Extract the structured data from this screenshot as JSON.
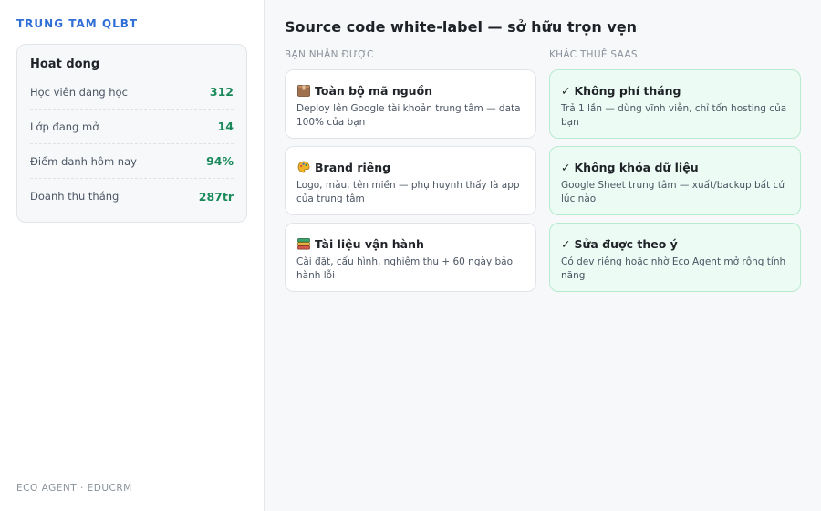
{
  "sidebar": {
    "brand": "TRUNG TAM QLBT",
    "stats": {
      "title": "Hoat dong",
      "rows": [
        {
          "label": "Học viên đang học",
          "value": "312"
        },
        {
          "label": "Lớp đang mở",
          "value": "14"
        },
        {
          "label": "Điểm danh hôm nay",
          "value": "94%"
        },
        {
          "label": "Doanh thu tháng",
          "value": "287tr"
        }
      ]
    },
    "footer": "ECO AGENT · EDUCRM"
  },
  "main": {
    "title": "Source code white-label — sở hữu trọn vẹn",
    "left": {
      "header": "BẠN NHẬN ĐƯỢC",
      "cards": [
        {
          "icon": "box-icon",
          "title": "Toàn bộ mã nguồn",
          "desc": "Deploy lên Google tài khoản trung tâm — data 100% của bạn"
        },
        {
          "icon": "palette-icon",
          "title": "Brand riêng",
          "desc": "Logo, màu, tên miền — phụ huynh thấy là app của trung tâm"
        },
        {
          "icon": "books-icon",
          "title": "Tài liệu vận hành",
          "desc": "Cài đặt, cấu hình, nghiệm thu + 60 ngày bảo hành lỗi"
        }
      ]
    },
    "right": {
      "header": "KHÁC THUÊ SAAS",
      "check": "✓",
      "cards": [
        {
          "title": "Không phí tháng",
          "desc": "Trả 1 lần — dùng vĩnh viễn, chỉ tốn hosting của bạn"
        },
        {
          "title": "Không khóa dữ liệu",
          "desc": "Google Sheet trung tâm — xuất/backup bất cứ lúc nào"
        },
        {
          "title": "Sửa được theo ý",
          "desc": "Có dev riêng hoặc nhờ Eco Agent mở rộng tính năng"
        }
      ]
    }
  },
  "colors": {
    "brand": "#2f6fd6",
    "stat_value": "#1a8a5a",
    "green_card_bg": "#ecfbf3",
    "green_card_border": "#b7ebcd"
  }
}
